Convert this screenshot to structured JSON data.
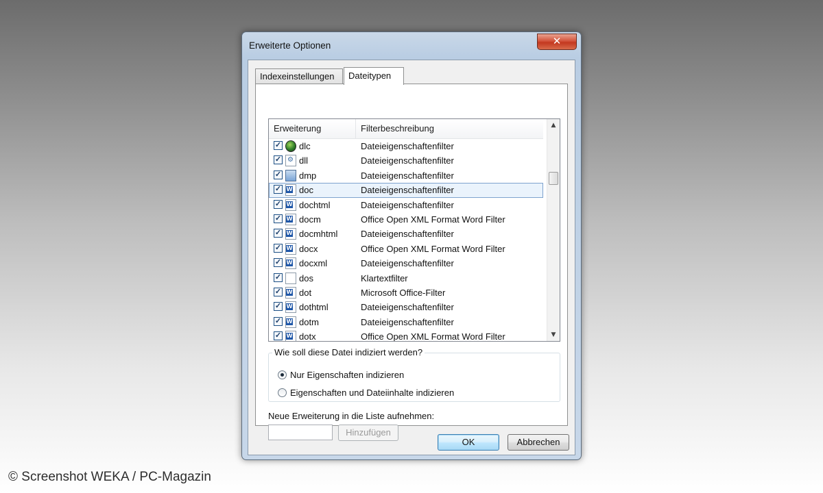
{
  "window": {
    "title": "Erweiterte Optionen",
    "close_label": "✕"
  },
  "tabs": [
    {
      "label": "Indexeinstellungen"
    },
    {
      "label": "Dateitypen"
    }
  ],
  "list": {
    "columns": {
      "extension": "Erweiterung",
      "description": "Filterbeschreibung"
    },
    "rows": [
      {
        "ext": "dlc",
        "desc": "Dateieigenschaftenfilter",
        "icon": "dlc-file-icon",
        "checked": true
      },
      {
        "ext": "dll",
        "desc": "Dateieigenschaftenfilter",
        "icon": "dll-file-icon",
        "checked": true
      },
      {
        "ext": "dmp",
        "desc": "Dateieigenschaftenfilter",
        "icon": "dmp-file-icon",
        "checked": true
      },
      {
        "ext": "doc",
        "desc": "Dateieigenschaftenfilter",
        "icon": "word-doc-icon",
        "checked": true,
        "selected": true
      },
      {
        "ext": "dochtml",
        "desc": "Dateieigenschaftenfilter",
        "icon": "word-doc-icon",
        "checked": true
      },
      {
        "ext": "docm",
        "desc": "Office Open XML Format Word Filter",
        "icon": "word-doc-icon",
        "checked": true
      },
      {
        "ext": "docmhtml",
        "desc": "Dateieigenschaftenfilter",
        "icon": "word-doc-icon",
        "checked": true
      },
      {
        "ext": "docx",
        "desc": "Office Open XML Format Word Filter",
        "icon": "word-doc-icon",
        "checked": true
      },
      {
        "ext": "docxml",
        "desc": "Dateieigenschaftenfilter",
        "icon": "word-doc-icon",
        "checked": true
      },
      {
        "ext": "dos",
        "desc": "Klartextfilter",
        "icon": "plain-file-icon",
        "checked": true
      },
      {
        "ext": "dot",
        "desc": "Microsoft Office-Filter",
        "icon": "word-doc-icon",
        "checked": true
      },
      {
        "ext": "dothtml",
        "desc": "Dateieigenschaftenfilter",
        "icon": "word-doc-icon",
        "checked": true
      },
      {
        "ext": "dotm",
        "desc": "Dateieigenschaftenfilter",
        "icon": "word-doc-icon",
        "checked": true
      },
      {
        "ext": "dotx",
        "desc": "Office Open XML Format Word Filter",
        "icon": "word-doc-icon",
        "checked": true
      }
    ]
  },
  "index_mode": {
    "legend": "Wie soll diese Datei indiziert werden?",
    "options": [
      {
        "label": "Nur Eigenschaften indizieren",
        "checked": true
      },
      {
        "label": "Eigenschaften und Dateiinhalte indizieren",
        "checked": false
      }
    ]
  },
  "new_extension": {
    "label": "Neue Erweiterung in die Liste aufnehmen:",
    "value": "",
    "add_label": "Hinzufügen"
  },
  "buttons": {
    "ok": "OK",
    "cancel": "Abbrechen"
  },
  "credit": "© Screenshot WEKA / PC-Magazin",
  "colors": {
    "accent": "#3c7fb1",
    "selection": "#eaf3fc",
    "close": "#c3381f"
  }
}
